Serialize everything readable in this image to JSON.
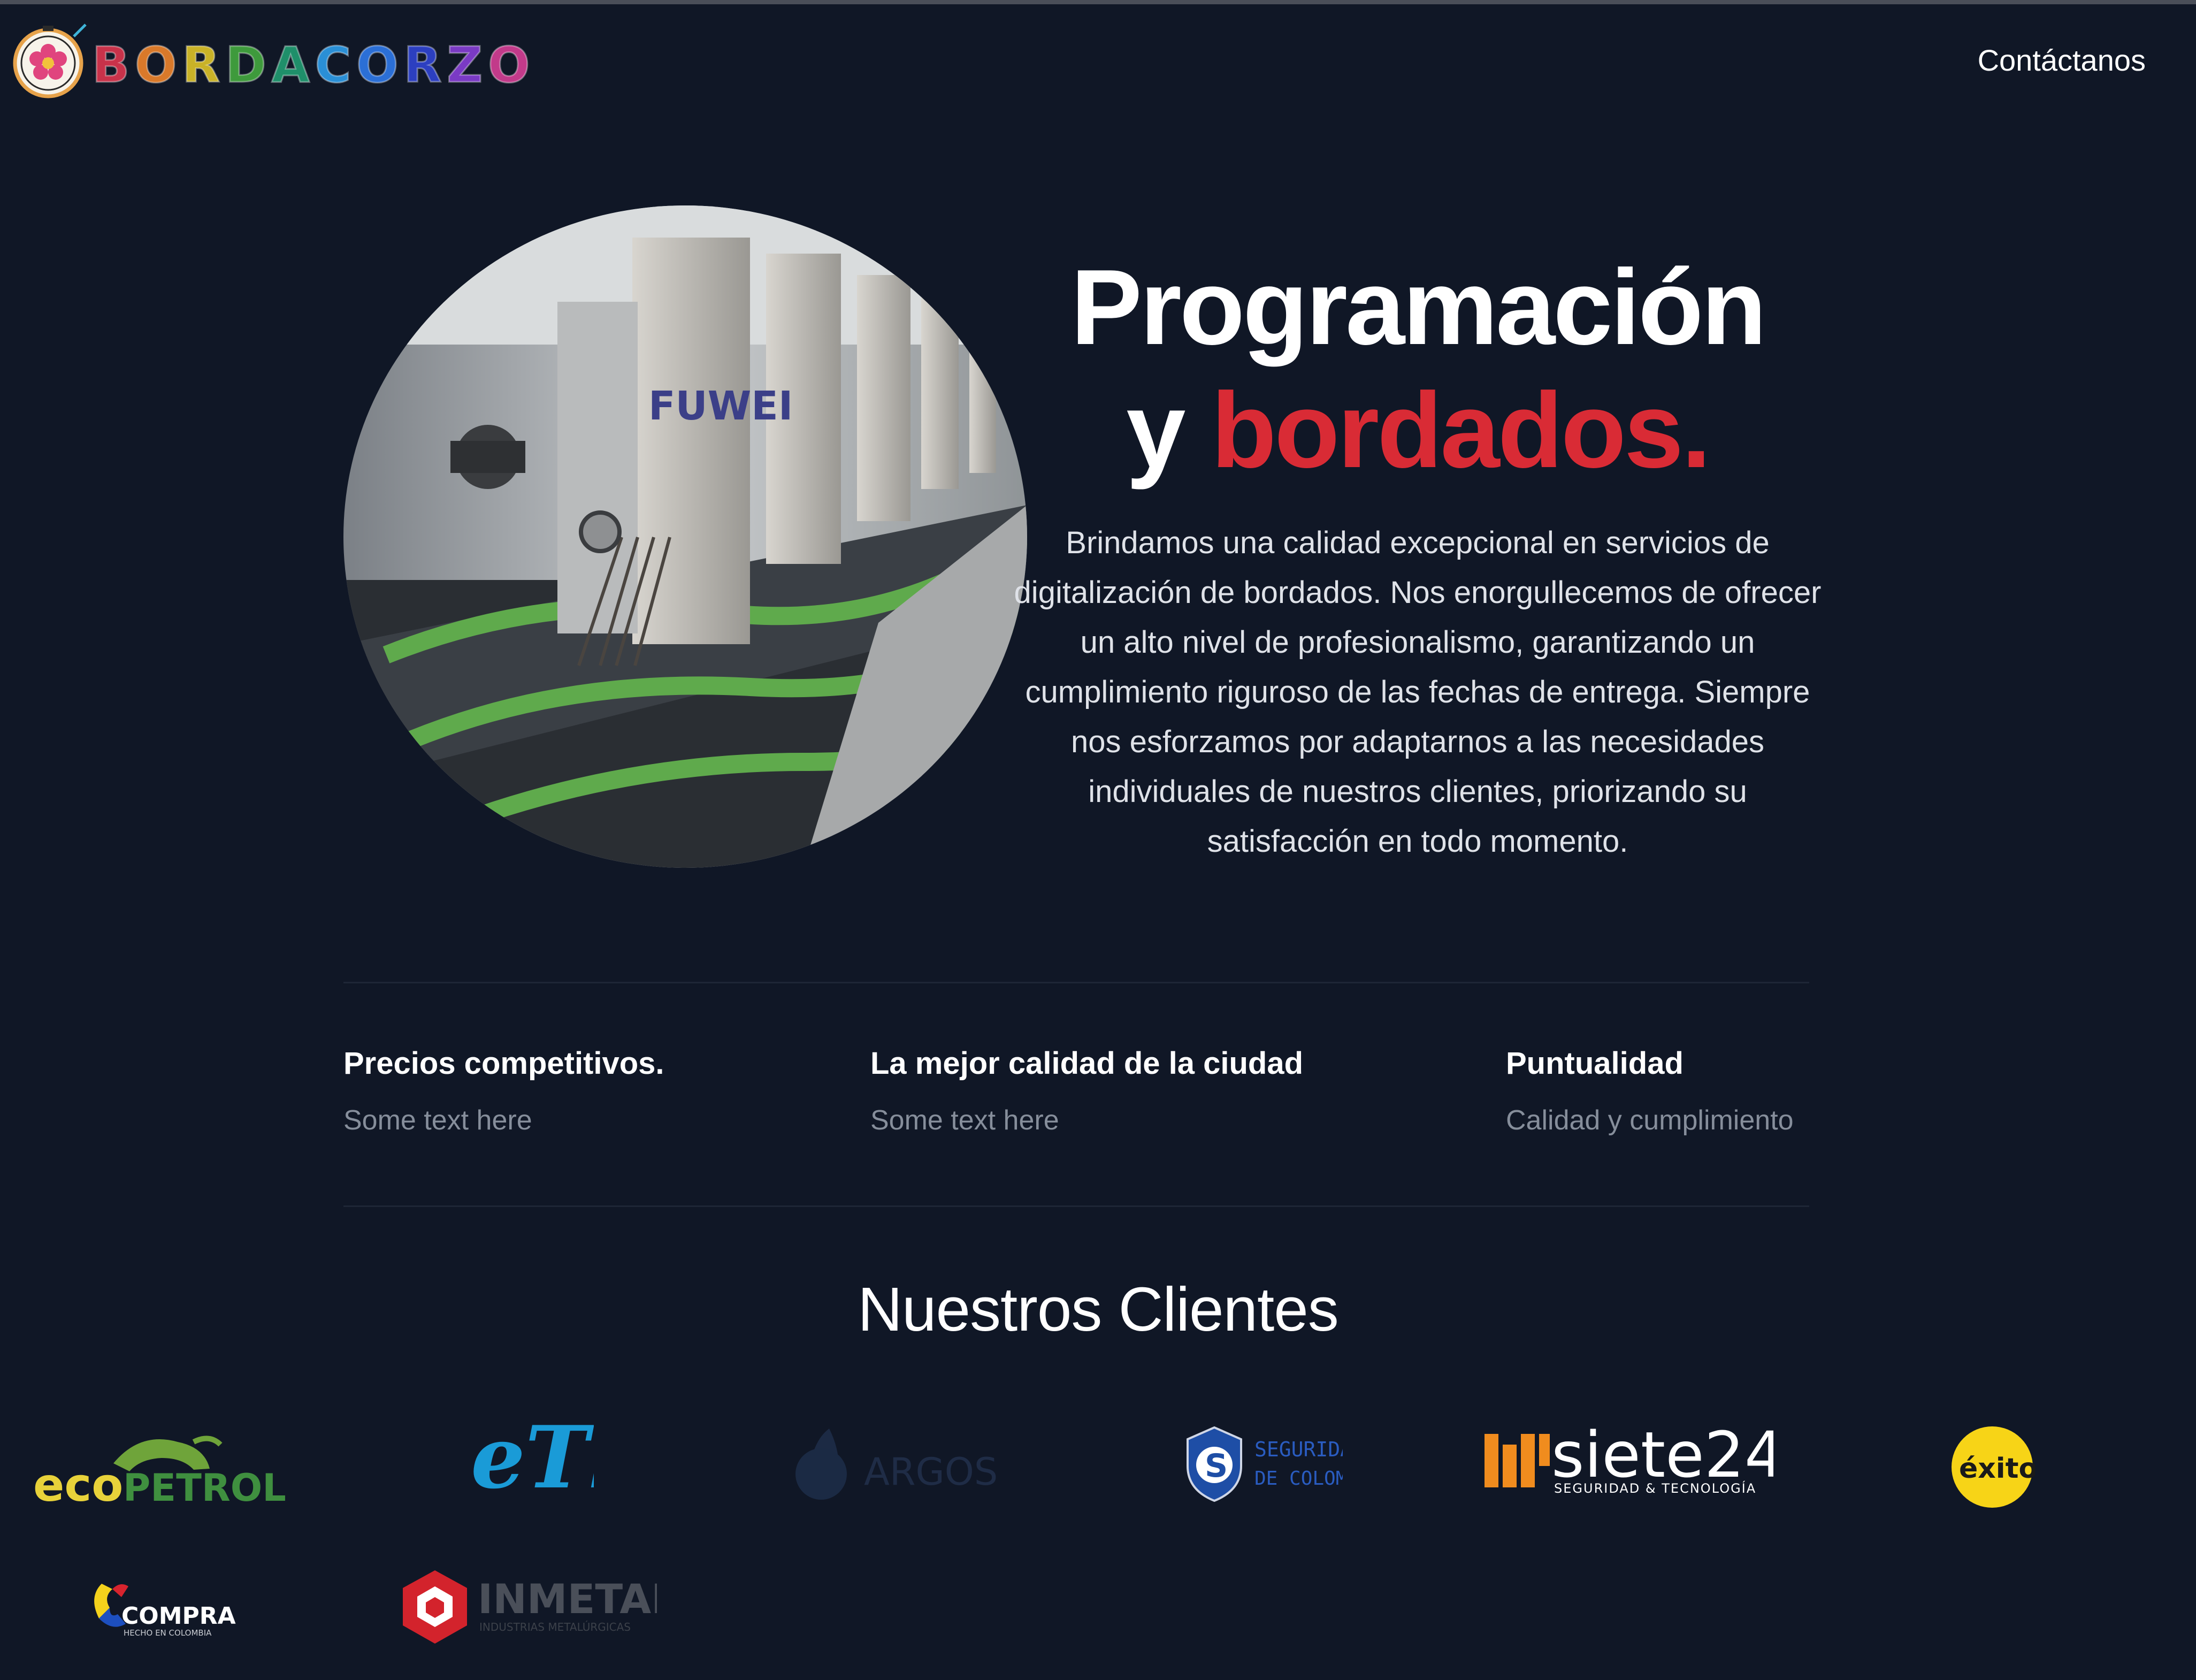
{
  "navbar": {
    "brand_letters": [
      {
        "ch": "B",
        "color": "#c8324a"
      },
      {
        "ch": "O",
        "color": "#d9792a"
      },
      {
        "ch": "R",
        "color": "#c9b227"
      },
      {
        "ch": "D",
        "color": "#3e9a3c"
      },
      {
        "ch": "A",
        "color": "#1f8f6a"
      },
      {
        "ch": "C",
        "color": "#2a8fd6"
      },
      {
        "ch": "O",
        "color": "#2b6fd6"
      },
      {
        "ch": "R",
        "color": "#2c3fc0"
      },
      {
        "ch": "Z",
        "color": "#7a3ac4"
      },
      {
        "ch": "O",
        "color": "#c23a8a"
      }
    ],
    "contact_label": "Contáctanos"
  },
  "hero": {
    "title_line1": "Programación",
    "title_line2_prefix": "y ",
    "title_line2_accent": "bordados.",
    "description": "Brindamos una calidad excepcional en servicios de digitalización de bordados. Nos enorgullecemos de ofrecer un alto nivel de profesionalismo, garantizando un cumplimiento riguroso de las fechas de entrega. Siempre nos esforzamos por adaptarnos a las necesidades individuales de nuestros clientes, priorizando su satisfacción en todo momento.",
    "image_brand_text": "FUWEI"
  },
  "features": [
    {
      "title": "Precios competitivos.",
      "text": "Some text here"
    },
    {
      "title": "La mejor calidad de la ciudad",
      "text": "Some text here"
    },
    {
      "title": "Puntualidad",
      "text": "Calidad y cumplimiento"
    }
  ],
  "clients": {
    "title": "Nuestros Clientes",
    "logos": [
      {
        "name": "ecopetrol",
        "text_a": "eco",
        "text_b": "PETROL"
      },
      {
        "name": "etb",
        "text": "eTb"
      },
      {
        "name": "argos",
        "text": "ARGOS"
      },
      {
        "name": "seguridad-de-colombia",
        "text_a": "SEGURIDAD",
        "text_b": "DE COLOMBIA",
        "initial": "S"
      },
      {
        "name": "siete24",
        "text_a": "siete24",
        "text_b": "SEGURIDAD & TECNOLOGÍA"
      },
      {
        "name": "exito",
        "text": "éxito"
      },
      {
        "name": "compra",
        "text_a": "COMPRA",
        "text_b": "HECHO EN COLOMBIA"
      },
      {
        "name": "inmetal",
        "text_a": "INMETAL",
        "text_b": "INDUSTRIAS METALÚRGICAS"
      }
    ]
  },
  "colors": {
    "background": "#101726",
    "accent": "#d92b35",
    "muted_text": "#868e9b"
  },
  "icons": [
    "flower-logo-icon"
  ]
}
